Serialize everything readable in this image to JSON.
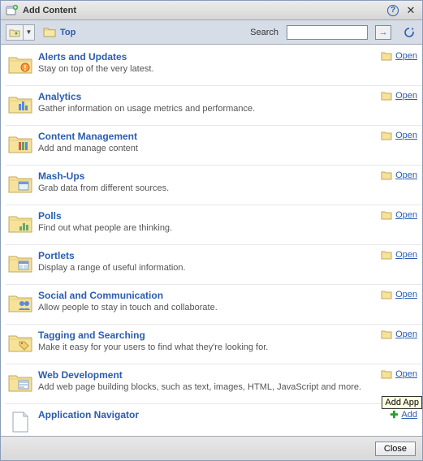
{
  "header": {
    "title": "Add Content"
  },
  "toolbar": {
    "top_label": "Top",
    "search_label": "Search",
    "search_value": "",
    "search_placeholder": ""
  },
  "items": [
    {
      "title": "Alerts and Updates",
      "desc": "Stay on top of the very latest.",
      "action": "Open",
      "action_type": "open",
      "icon": "folder-alerts"
    },
    {
      "title": "Analytics",
      "desc": "Gather information on usage metrics and performance.",
      "action": "Open",
      "action_type": "open",
      "icon": "folder-analytics"
    },
    {
      "title": "Content Management",
      "desc": "Add and manage content",
      "action": "Open",
      "action_type": "open",
      "icon": "folder-content"
    },
    {
      "title": "Mash-Ups",
      "desc": "Grab data from different sources.",
      "action": "Open",
      "action_type": "open",
      "icon": "folder-mashups"
    },
    {
      "title": "Polls",
      "desc": "Find out what people are thinking.",
      "action": "Open",
      "action_type": "open",
      "icon": "folder-polls"
    },
    {
      "title": "Portlets",
      "desc": "Display a range of useful information.",
      "action": "Open",
      "action_type": "open",
      "icon": "folder-portlets"
    },
    {
      "title": "Social and Communication",
      "desc": "Allow people to stay in touch and collaborate.",
      "action": "Open",
      "action_type": "open",
      "icon": "folder-social"
    },
    {
      "title": "Tagging and Searching",
      "desc": "Make it easy for your users to find what they're looking for.",
      "action": "Open",
      "action_type": "open",
      "icon": "folder-tagging"
    },
    {
      "title": "Web Development",
      "desc": "Add web page building blocks, such as text, images, HTML, JavaScript and more.",
      "action": "Open",
      "action_type": "open",
      "icon": "folder-webdev"
    },
    {
      "title": "Application Navigator",
      "desc": "",
      "action": "Add",
      "action_type": "add",
      "icon": "document"
    }
  ],
  "footer": {
    "close_label": "Close"
  },
  "tooltip": "Add App"
}
